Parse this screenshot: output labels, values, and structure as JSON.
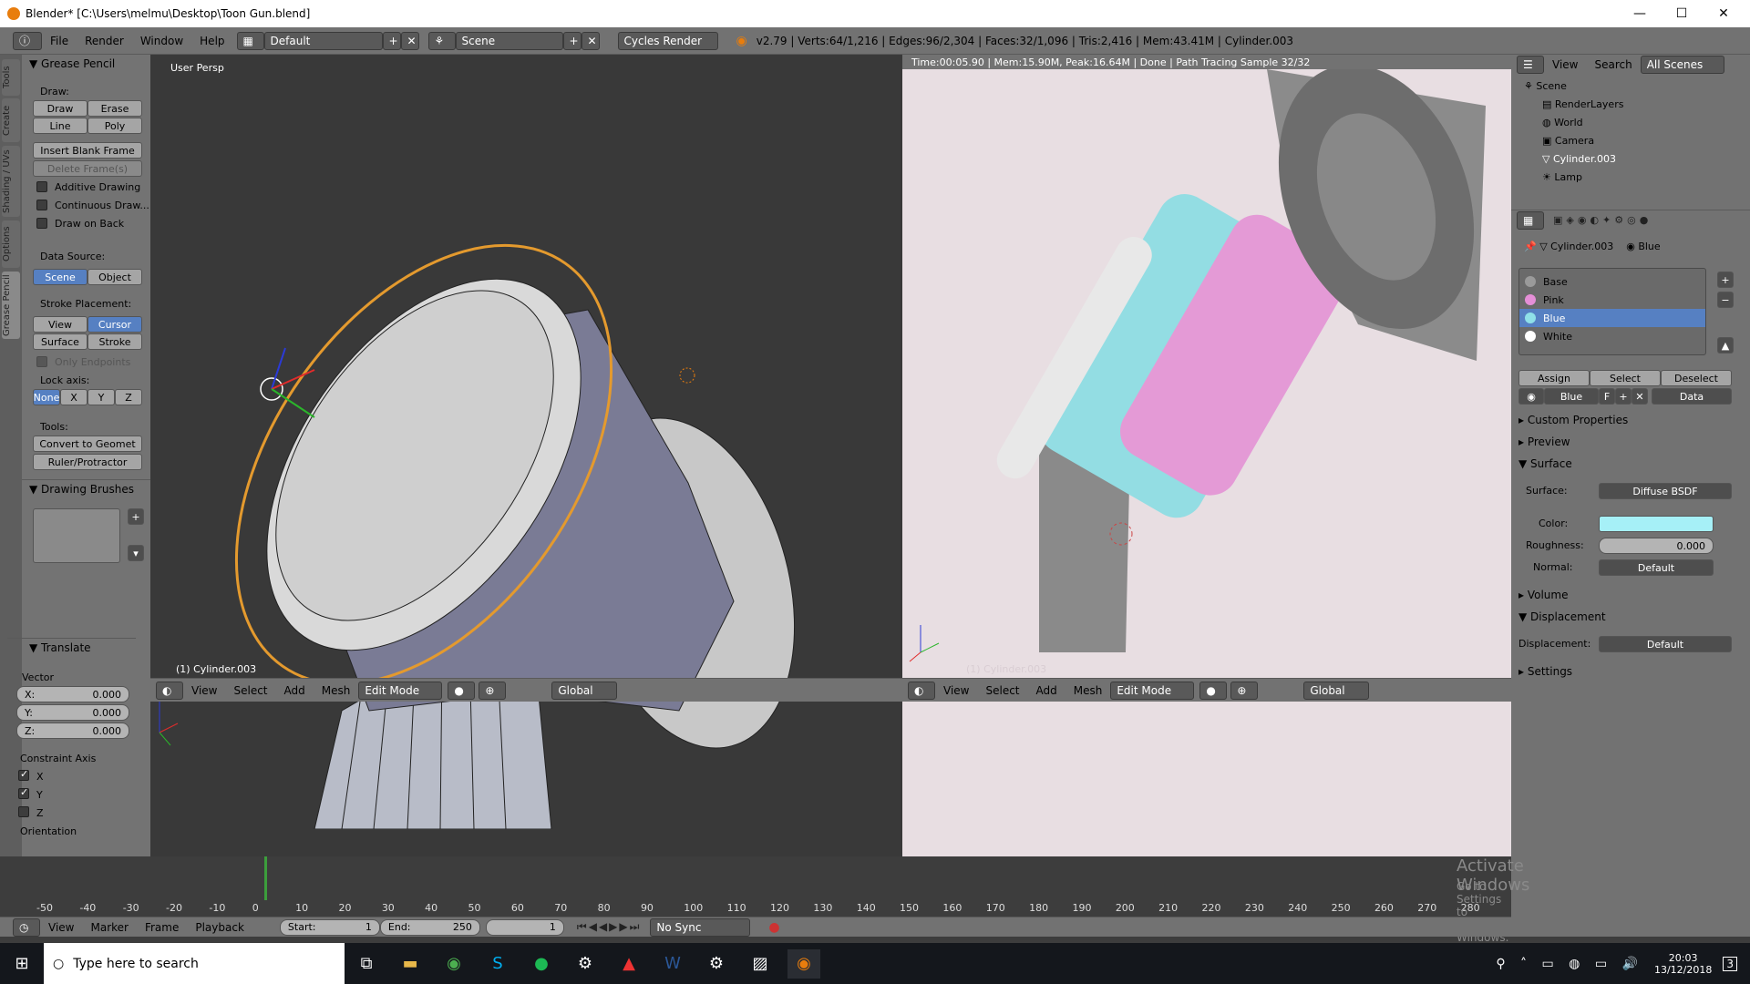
{
  "window": {
    "title": "Blender* [C:\\Users\\melmu\\Desktop\\Toon Gun.blend]",
    "minimize": "—",
    "maximize": "☐",
    "close": "✕"
  },
  "topbar": {
    "menus": [
      "File",
      "Render",
      "Window",
      "Help"
    ],
    "layout": "Default",
    "scene": "Scene",
    "engine": "Cycles Render",
    "stats": "v2.79 | Verts:64/1,216 | Edges:96/2,304 | Faces:32/1,096 | Tris:2,416 | Mem:43.41M | Cylinder.003"
  },
  "toolshelf": {
    "tabs": [
      "Tools",
      "Create",
      "Shading / UVs",
      "Options",
      "Grease Pencil"
    ],
    "grease_pencil": "Grease Pencil",
    "draw_label": "Draw:",
    "draw": "Draw",
    "erase": "Erase",
    "line": "Line",
    "poly": "Poly",
    "insert_blank": "Insert Blank Frame",
    "delete_frames": "Delete Frame(s)",
    "additive": "Additive Drawing",
    "continuous": "Continuous Draw...",
    "draw_back": "Draw on Back",
    "data_source": "Data Source:",
    "scene": "Scene",
    "object": "Object",
    "stroke_placement": "Stroke Placement:",
    "view": "View",
    "cursor": "Cursor",
    "surface": "Surface",
    "stroke": "Stroke",
    "only_endpoints": "Only Endpoints",
    "lock_axis": "Lock axis:",
    "none": "None",
    "x": "X",
    "y": "Y",
    "z": "Z",
    "tools": "Tools:",
    "convert": "Convert to Geomet",
    "ruler": "Ruler/Protractor",
    "brushes": "Drawing Brushes",
    "translate": "Translate",
    "vector": "Vector",
    "vx": {
      "label": "X:",
      "value": "0.000"
    },
    "vy": {
      "label": "Y:",
      "value": "0.000"
    },
    "vz": {
      "label": "Z:",
      "value": "0.000"
    },
    "constraint": "Constraint Axis",
    "cx": "X",
    "cy": "Y",
    "cz": "Z",
    "orientation": "Orientation"
  },
  "viewport1": {
    "label": "User Persp",
    "object": "(1) Cylinder.003",
    "header": {
      "view": "View",
      "select": "Select",
      "add": "Add",
      "mesh": "Mesh",
      "mode": "Edit Mode",
      "orient": "Global"
    }
  },
  "viewport2": {
    "status": "Time:00:05.90 | Mem:15.90M, Peak:16.64M | Done | Path Tracing Sample 32/32",
    "object": "(1) Cylinder.003",
    "header": {
      "view": "View",
      "select": "Select",
      "add": "Add",
      "mesh": "Mesh",
      "mode": "Edit Mode",
      "orient": "Global"
    }
  },
  "outliner": {
    "view": "View",
    "search": "Search",
    "filter": "All Scenes",
    "items": [
      "Scene",
      "RenderLayers",
      "World",
      "Camera",
      "Cylinder.003",
      "Lamp"
    ]
  },
  "properties": {
    "breadcrumb_obj": "Cylinder.003",
    "breadcrumb_mat": "Blue",
    "slots": [
      "Base",
      "Pink",
      "Blue",
      "White"
    ],
    "slot_colors": [
      "#9a9a9a",
      "#e58fd7",
      "#8fe0e8",
      "#ffffff"
    ],
    "assign": "Assign",
    "select": "Select",
    "deselect": "Deselect",
    "material_name": "Blue",
    "f": "F",
    "link": "Data",
    "custom_props": "Custom Properties",
    "preview": "Preview",
    "surface": "Surface",
    "surface_label": "Surface:",
    "surface_value": "Diffuse BSDF",
    "color_label": "Color:",
    "color_value": "#a6f0f7",
    "roughness_label": "Roughness:",
    "roughness_value": "0.000",
    "normal_label": "Normal:",
    "normal_value": "Default",
    "volume": "Volume",
    "displacement": "Displacement",
    "displacement_label": "Displacement:",
    "displacement_value": "Default",
    "settings": "Settings"
  },
  "timeline": {
    "ticks": [
      "-50",
      "-40",
      "-30",
      "-20",
      "-10",
      "0",
      "10",
      "20",
      "30",
      "40",
      "50",
      "60",
      "70",
      "80",
      "90",
      "100",
      "110",
      "120",
      "130",
      "140",
      "150",
      "160",
      "170",
      "180",
      "190",
      "200",
      "210",
      "220",
      "230",
      "240",
      "250",
      "260",
      "270",
      "280"
    ],
    "view": "View",
    "marker": "Marker",
    "frame": "Frame",
    "playback": "Playback",
    "start_label": "Start:",
    "start": "1",
    "end_label": "End:",
    "end": "250",
    "current": "1",
    "sync": "No Sync",
    "watermark1": "Activate Windows",
    "watermark2": "Go to Settings to activate Windows."
  },
  "taskbar": {
    "search": "Type here to search",
    "time": "20:03",
    "date": "13/12/2018",
    "notif": "3"
  }
}
